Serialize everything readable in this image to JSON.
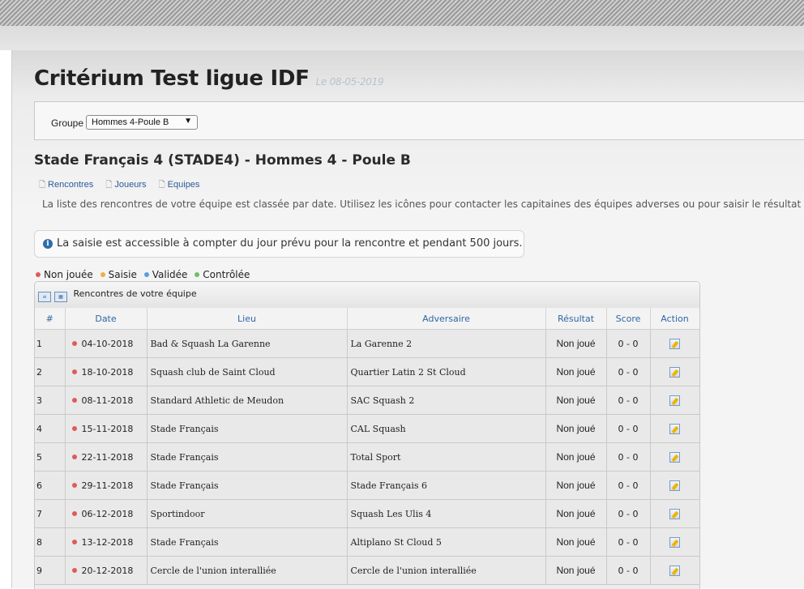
{
  "page": {
    "title": "Critérium Test ligue IDF",
    "date": "Le 08-05-2019"
  },
  "group": {
    "label": "Groupe",
    "selected": "Hommes 4-Poule B"
  },
  "team": {
    "title": "Stade Français 4 (STADE4) - Hommes 4 - Poule B"
  },
  "links": [
    "Rencontres",
    "Joueurs",
    "Equipes"
  ],
  "intro": "La liste des rencontres de votre équipe est classée par date. Utilisez les icônes pour contacter les capitaines des équipes adverses ou pour saisir le résultat de la rencontre.",
  "info": "La saisie est accessible à compter du jour prévu pour la rencontre et pendant 500 jours.",
  "legend": [
    {
      "label": "Non jouée",
      "color": "#e05a5a"
    },
    {
      "label": "Saisie",
      "color": "#f0b040"
    },
    {
      "label": "Validée",
      "color": "#5aa0e0"
    },
    {
      "label": "Contrôlée",
      "color": "#6cc06c"
    }
  ],
  "grid": {
    "caption": "Rencontres de votre équipe",
    "columns": [
      "#",
      "Date",
      "Lieu",
      "Adversaire",
      "Résultat",
      "Score",
      "Action"
    ],
    "rows": [
      {
        "num": "1",
        "date": "04-10-2018",
        "lieu": "Bad & Squash La Garenne",
        "adversaire": "La Garenne 2",
        "resultat": "Non joué",
        "score": "0 - 0"
      },
      {
        "num": "2",
        "date": "18-10-2018",
        "lieu": "Squash club de Saint Cloud",
        "adversaire": "Quartier Latin 2 St Cloud",
        "resultat": "Non joué",
        "score": "0 - 0"
      },
      {
        "num": "3",
        "date": "08-11-2018",
        "lieu": "Standard Athletic de Meudon",
        "adversaire": "SAC Squash 2",
        "resultat": "Non joué",
        "score": "0 - 0"
      },
      {
        "num": "4",
        "date": "15-11-2018",
        "lieu": "Stade Français",
        "adversaire": "CAL Squash",
        "resultat": "Non joué",
        "score": "0 - 0"
      },
      {
        "num": "5",
        "date": "22-11-2018",
        "lieu": "Stade Français",
        "adversaire": "Total Sport",
        "resultat": "Non joué",
        "score": "0 - 0"
      },
      {
        "num": "6",
        "date": "29-11-2018",
        "lieu": "Stade Français",
        "adversaire": "Stade Français 6",
        "resultat": "Non joué",
        "score": "0 - 0"
      },
      {
        "num": "7",
        "date": "06-12-2018",
        "lieu": "Sportindoor",
        "adversaire": "Squash Les Ulis 4",
        "resultat": "Non joué",
        "score": "0 - 0"
      },
      {
        "num": "8",
        "date": "13-12-2018",
        "lieu": "Stade Français",
        "adversaire": "Altiplano St Cloud 5",
        "resultat": "Non joué",
        "score": "0 - 0"
      },
      {
        "num": "9",
        "date": "20-12-2018",
        "lieu": "Cercle de l'union interalliée",
        "adversaire": "Cercle de l'union interalliée",
        "resultat": "Non joué",
        "score": "0 - 0"
      }
    ]
  }
}
